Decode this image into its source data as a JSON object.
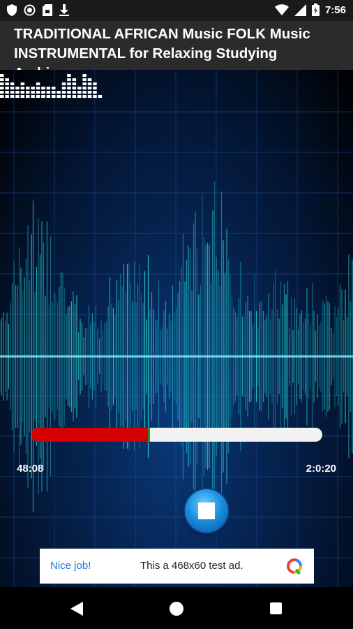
{
  "status_bar": {
    "time": "7:56",
    "left_icons": [
      "shield-icon",
      "record-icon",
      "sim-card-icon",
      "download-icon"
    ],
    "right_icons": [
      "wifi-icon",
      "signal-icon",
      "battery-icon"
    ]
  },
  "header": {
    "title": "TRADITIONAL AFRICAN Music FOLK Music INSTRUMENTAL for Relaxing Studying Ambience"
  },
  "player": {
    "progress_fraction": 0.4,
    "elapsed": "48:08",
    "total": "2:0:20",
    "stop_icon": "stop-icon",
    "equalizer_icon": "equalizer-icon",
    "colors": {
      "progress_fill": "#d40000",
      "progress_track": "#f2f2f2",
      "accent": "#1a90e0"
    }
  },
  "ad": {
    "nice": "Nice job!",
    "text": "This a 468x60 test ad.",
    "logo_icon": "ad-logo-icon"
  },
  "nav_bar": {
    "back_icon": "back-icon",
    "home_icon": "home-icon",
    "recents_icon": "recents-icon"
  }
}
